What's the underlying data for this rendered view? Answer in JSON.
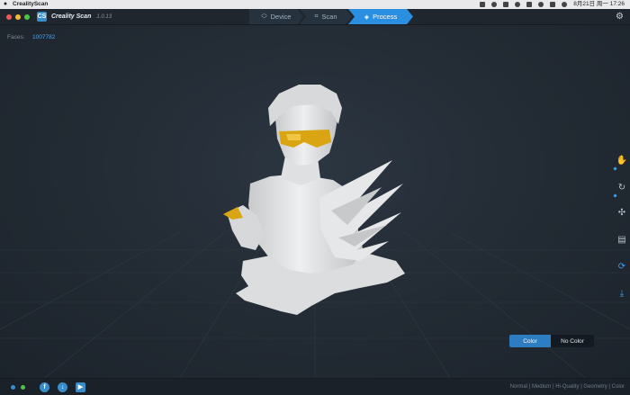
{
  "menubar": {
    "apple": "",
    "app_name": "CrealityScan",
    "clock": "8月21日 周一 17:26"
  },
  "titlebar": {
    "logo": "CS",
    "title": "Creality Scan",
    "version": "1.0.13",
    "modes": [
      {
        "label": "Device",
        "icon": "⬭"
      },
      {
        "label": "Scan",
        "icon": "⌗"
      },
      {
        "label": "Process",
        "icon": "◈"
      }
    ],
    "settings_icon": "⚙"
  },
  "viewport": {
    "faces_label": "Faces:",
    "faces_value": "1007782"
  },
  "right_toolbar": {
    "icons": [
      "hand-icon",
      "rotate-icon",
      "transform-icon",
      "measure-icon",
      "refresh-icon",
      "download-icon"
    ]
  },
  "color_toggle": {
    "color_label": "Color",
    "no_color_label": "No Color",
    "active": "Color"
  },
  "bottombar": {
    "render_modes": "Normal | Medium | Hi-Quality | Geometry | Color"
  },
  "colors": {
    "accent": "#2a8fe0",
    "background": "#222a33",
    "model": "#e4e5e6",
    "glasses": "#d9a512"
  }
}
